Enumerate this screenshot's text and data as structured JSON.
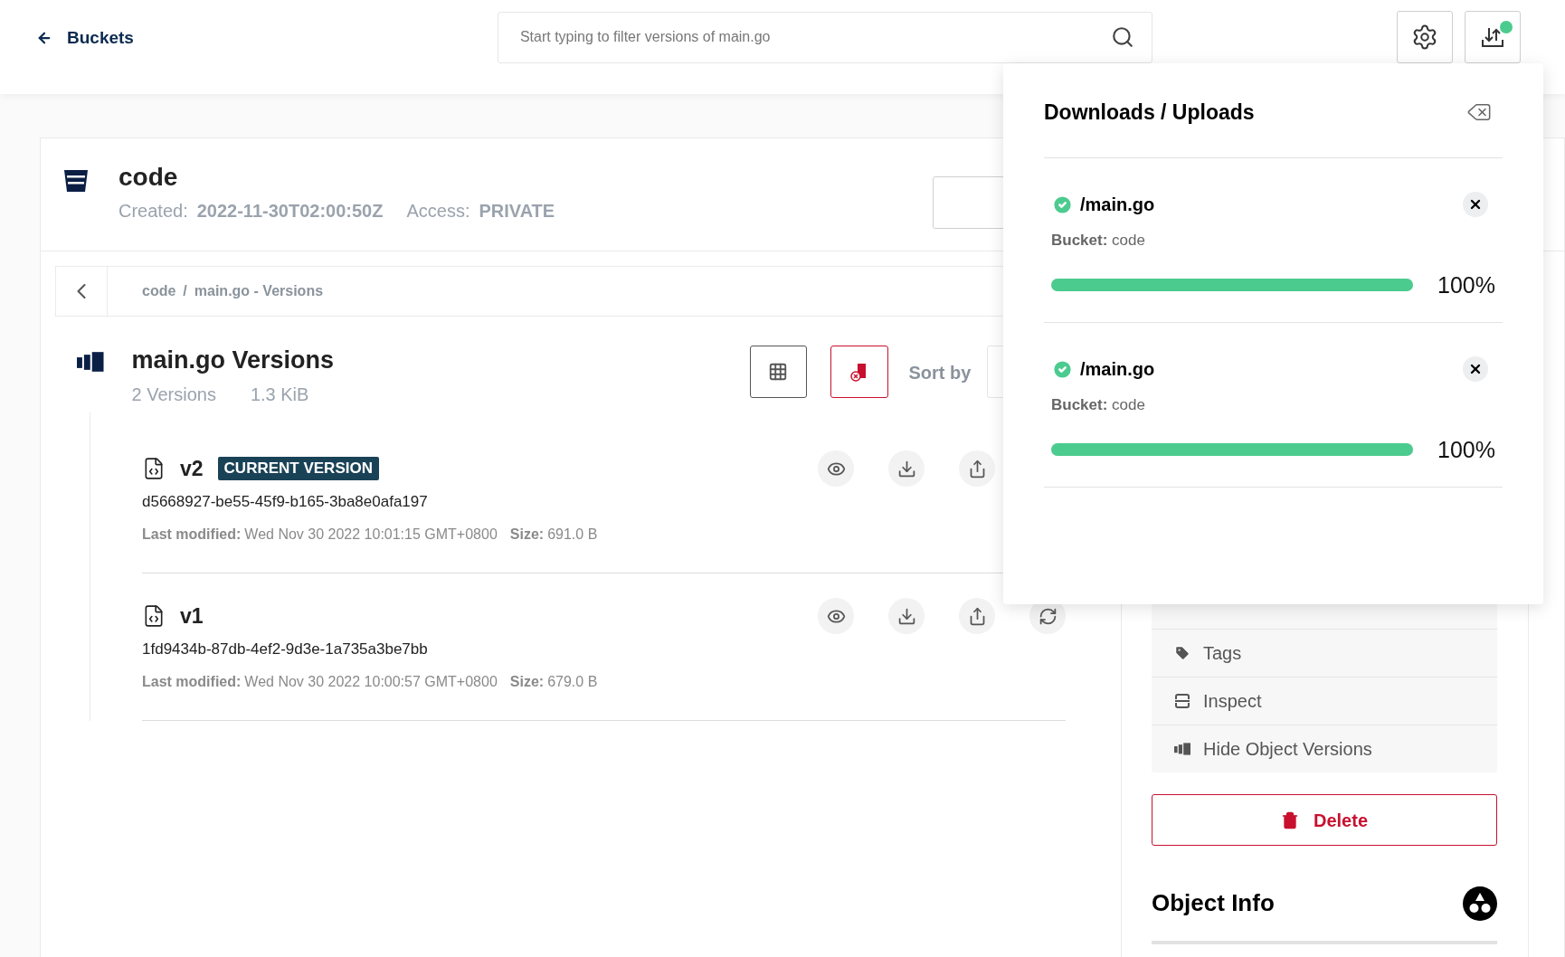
{
  "header": {
    "back_label": "Buckets",
    "search": {
      "placeholder": "Start typing to filter versions of main.go"
    },
    "downloads_badge": true
  },
  "bucket": {
    "name": "code",
    "created_label": "Created:",
    "created": "2022-11-30T02:00:50Z",
    "access_label": "Access:",
    "access": "PRIVATE"
  },
  "breadcrumb": {
    "parts": [
      "code",
      "main.go - Versions"
    ],
    "separator": "/"
  },
  "versions_panel": {
    "title": "main.go Versions",
    "count": "2 Versions",
    "size": "1.3 KiB",
    "sort_label": "Sort by"
  },
  "versions": [
    {
      "name": "v2",
      "badge": "CURRENT VERSION",
      "id": "d5668927-be55-45f9-b165-3ba8e0afa197",
      "modified_label": "Last modified:",
      "modified": "Wed Nov 30 2022 10:01:15 GMT+0800",
      "size_label": "Size:",
      "size": "691.0 B"
    },
    {
      "name": "v1",
      "id": "1fd9434b-87db-4ef2-9d3e-1a735a3be7bb",
      "modified_label": "Last modified:",
      "modified": "Wed Nov 30 2022 10:00:57 GMT+0800",
      "size_label": "Size:",
      "size": "679.0 B"
    }
  ],
  "actions": [
    {
      "kind": "tags",
      "label": "Tags"
    },
    {
      "kind": "inspect",
      "label": "Inspect"
    },
    {
      "kind": "versions",
      "label": "Hide Object Versions"
    }
  ],
  "delete_button": "Delete",
  "object_info": {
    "title": "Object Info"
  },
  "transfers": {
    "title": "Downloads / Uploads",
    "items": [
      {
        "path": "/main.go",
        "done": true,
        "bucket_label": "Bucket:",
        "bucket": "code",
        "level": 1,
        "reading": "100%"
      },
      {
        "path": "/main.go",
        "done": true,
        "bucket_label": "Bucket:",
        "bucket": "code",
        "level": 1,
        "reading": "100%"
      }
    ]
  }
}
